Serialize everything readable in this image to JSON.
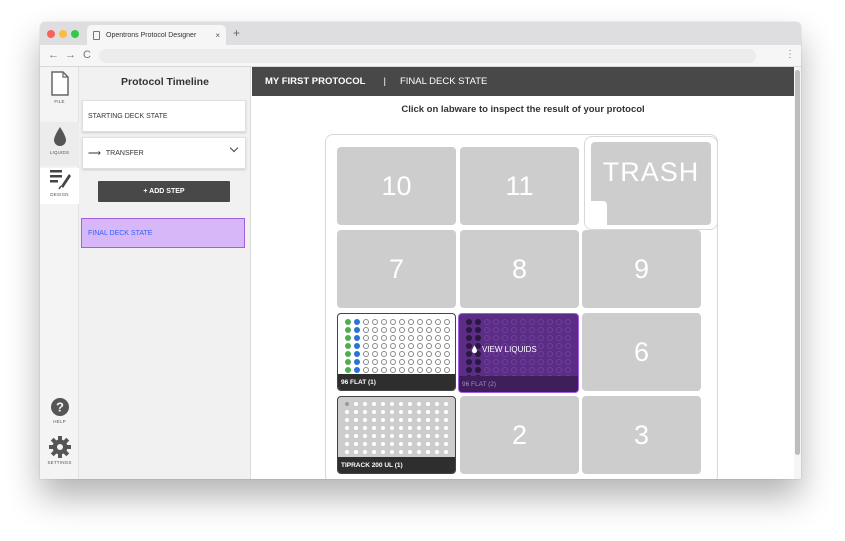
{
  "browser": {
    "tab_title": "Opentrons Protocol Designer",
    "tab_close": "×",
    "new_tab": "+",
    "back": "←",
    "forward": "→",
    "reload": "C",
    "menu": "⋮"
  },
  "nav": {
    "items": [
      {
        "label": "FILE",
        "icon": "file-icon"
      },
      {
        "label": "LIQUIDS",
        "icon": "droplet-icon"
      },
      {
        "label": "DESIGN",
        "icon": "pipette-icon"
      },
      {
        "label": "HELP",
        "icon": "help-icon"
      },
      {
        "label": "SETTINGS",
        "icon": "gear-icon"
      }
    ]
  },
  "sidebar": {
    "title": "Protocol Timeline",
    "starting_deck": "STARTING DECK STATE",
    "transfer_label": "TRANSFER",
    "add_step": "+ ADD STEP",
    "final_deck": "FINAL DECK STATE"
  },
  "main": {
    "protocol_name": "MY FIRST PROTOCOL",
    "separator": "|",
    "section": "FINAL DECK STATE",
    "hint": "Click on labware to inspect the result of your protocol"
  },
  "deck": {
    "slots": [
      "10",
      "11",
      "7",
      "8",
      "9",
      "6",
      "2",
      "3"
    ],
    "trash": "TRASH",
    "labware_1": "96 FLAT (1)",
    "labware_2": "96 FLAT (2)",
    "view_liquids": "VIEW LIQUIDS",
    "tiprack": "TIPRACK 200 UL (1)"
  },
  "colors": {
    "selected_fill": "#d7b7f8",
    "selected_border": "#a45ce0",
    "liquid_green": "#4cae4c",
    "liquid_blue": "#2a74d4",
    "hover_overlay": "#5c2d86"
  }
}
